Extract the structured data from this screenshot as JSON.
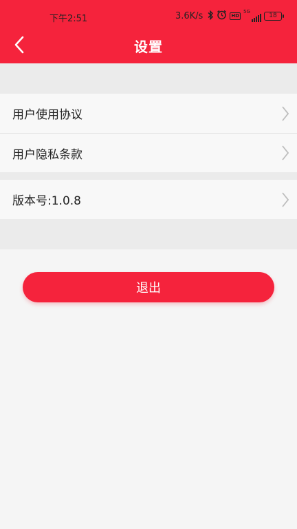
{
  "status_bar": {
    "time": "下午2:51",
    "network_speed": "3.6K/s",
    "signal_label": "5G",
    "hd_label": "HD",
    "battery": "18",
    "icons": [
      "bluetooth-icon",
      "alarm-icon",
      "hd-icon",
      "signal-icon",
      "battery-icon"
    ]
  },
  "header": {
    "title": "设置",
    "back_icon": "chevron-left-icon",
    "background": "#f5233c"
  },
  "settings": {
    "items": [
      {
        "label": "用户使用协议"
      },
      {
        "label": "用户隐私条款"
      },
      {
        "label": "版本号:1.0.8"
      }
    ]
  },
  "actions": {
    "logout_label": "退出",
    "accent": "#f5233c"
  }
}
